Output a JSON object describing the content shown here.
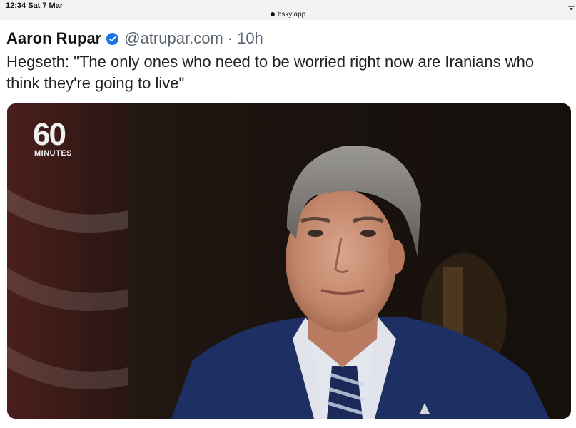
{
  "status_bar": {
    "time": "12:34  Sat 7 Mar",
    "url": "bsky.app"
  },
  "post": {
    "author_name": "Aaron Rupar",
    "handle": "@atrupar.com",
    "separator": "·",
    "time": "10h",
    "text": "Hegseth: \"The only ones who need to be worried right now are Iranians who think they're going to live\""
  },
  "media": {
    "logo_number": "60",
    "logo_word": "MINUTES",
    "description_icon": "video-frame"
  },
  "colors": {
    "verified": "#1a73e8",
    "handle": "#5b6570",
    "text": "#222222",
    "suit": "#1d2f63"
  }
}
